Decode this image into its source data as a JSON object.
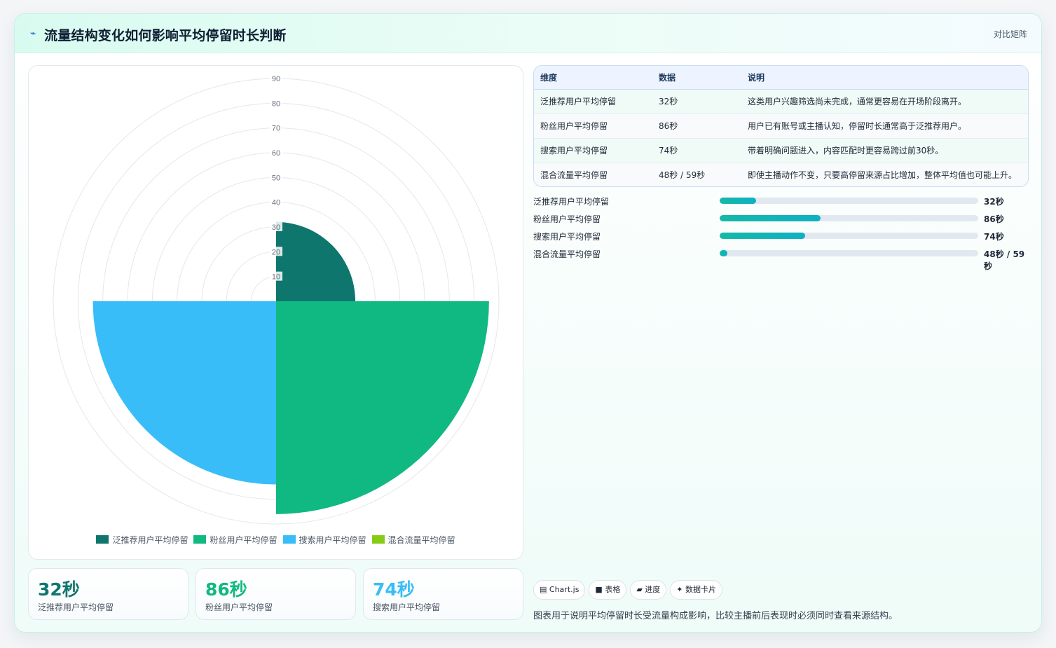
{
  "header": {
    "title_icon": "trend-icon",
    "title": "流量结构变化如何影响平均停留时长判断",
    "mode_label": "对比矩阵"
  },
  "colors": {
    "teal_dark": "#0f766e",
    "green": "#10b981",
    "sky": "#38bdf8",
    "lime": "#84cc16",
    "kpi_teal": "#0f766e",
    "kpi_green": "#10b981",
    "kpi_sky": "#38bdf8"
  },
  "chart_data": {
    "type": "polarArea",
    "categories": [
      "泛推荐用户平均停留",
      "粉丝用户平均停留",
      "搜索用户平均停留",
      "混合流量平均停留"
    ],
    "values": [
      32,
      86,
      74,
      0
    ],
    "series_colors": [
      "#0f766e",
      "#10b981",
      "#38bdf8",
      "#84cc16"
    ],
    "r_range": [
      0,
      90
    ],
    "r_ticks": [
      "10",
      "20",
      "30",
      "40",
      "50",
      "60",
      "70",
      "80",
      "90"
    ],
    "grid": true,
    "legend_position": "bottom"
  },
  "table": {
    "headers": [
      "维度",
      "数据",
      "说明"
    ],
    "rows": [
      {
        "dim": "泛推荐用户平均停留",
        "value": "32秒",
        "desc": "这类用户兴趣筛选尚未完成，通常更容易在开场阶段离开。"
      },
      {
        "dim": "粉丝用户平均停留",
        "value": "86秒",
        "desc": "用户已有账号或主播认知，停留时长通常高于泛推荐用户。"
      },
      {
        "dim": "搜索用户平均停留",
        "value": "74秒",
        "desc": "带着明确问题进入，内容匹配时更容易跨过前30秒。"
      },
      {
        "dim": "混合流量平均停留",
        "value": "48秒 / 59秒",
        "desc": "即使主播动作不变，只要高停留来源占比增加，整体平均值也可能上升。"
      }
    ]
  },
  "progress": [
    {
      "label": "泛推荐用户平均停留",
      "value_text": "32秒",
      "fraction": 0.14
    },
    {
      "label": "粉丝用户平均停留",
      "value_text": "86秒",
      "fraction": 0.39
    },
    {
      "label": "搜索用户平均停留",
      "value_text": "74秒",
      "fraction": 0.33
    },
    {
      "label": "混合流量平均停留",
      "value_text": "48秒 / 59秒",
      "fraction": 0.03
    }
  ],
  "kpis": [
    {
      "value": "32秒",
      "label": "泛推荐用户平均停留"
    },
    {
      "value": "86秒",
      "label": "粉丝用户平均停留"
    },
    {
      "value": "74秒",
      "label": "搜索用户平均停留"
    }
  ],
  "chips": [
    {
      "icon": "chart-icon",
      "glyph": "▤",
      "label": "Chart.js"
    },
    {
      "icon": "table-icon",
      "glyph": "■",
      "label": "表格"
    },
    {
      "icon": "progress-icon",
      "glyph": "▰",
      "label": "进度"
    },
    {
      "icon": "card-icon",
      "glyph": "✦",
      "label": "数据卡片"
    }
  ],
  "note": "图表用于说明平均停留时长受流量构成影响，比较主播前后表现时必须同时查看来源结构。"
}
